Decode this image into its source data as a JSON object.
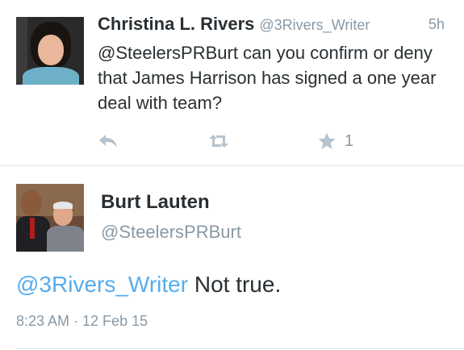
{
  "tweet": {
    "author_name": "Christina L. Rivers",
    "author_handle": "@3Rivers_Writer",
    "time_ago": "5h",
    "text": "@SteelersPRBurt can you confirm or deny that James Harrison has signed a one year deal with team?",
    "favorite_count": "1",
    "icons": [
      "reply-icon",
      "retweet-icon",
      "favorite-icon"
    ]
  },
  "reply": {
    "author_name": "Burt Lauten",
    "author_handle": "@SteelersPRBurt",
    "mention": "@3Rivers_Writer",
    "text": " Not true.",
    "timestamp": "8:23 AM · 12 Feb 15"
  },
  "colors": {
    "link": "#55acee",
    "muted": "#8899a6",
    "icon": "#b6c3cd",
    "text": "#292f33",
    "divider": "#e1e8ed"
  }
}
